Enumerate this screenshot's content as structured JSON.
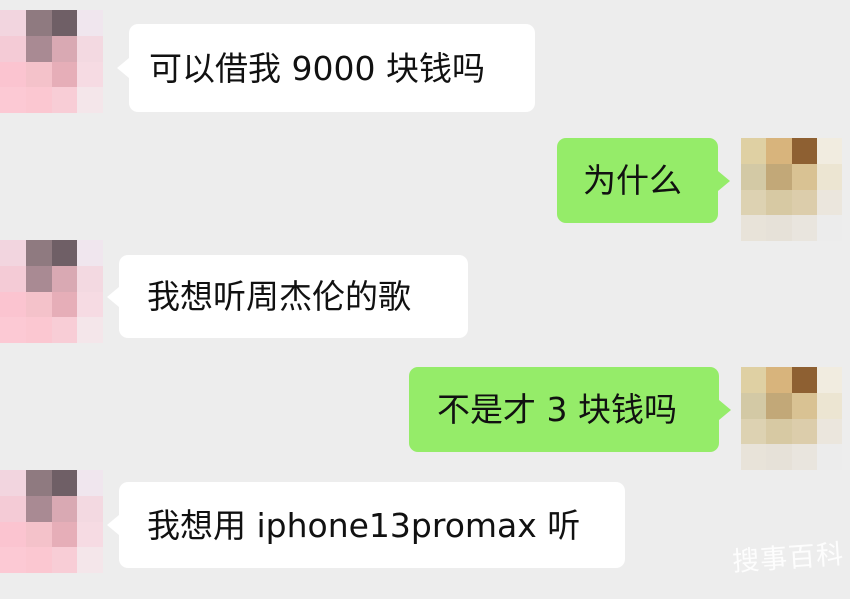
{
  "colors": {
    "background": "#ededed",
    "incoming_bubble": "#ffffff",
    "outgoing_bubble": "#95ec69"
  },
  "messages": [
    {
      "side": "in",
      "text": "可以借我 9000 块钱吗"
    },
    {
      "side": "out",
      "text": "为什么"
    },
    {
      "side": "in",
      "text": "我想听周杰伦的歌"
    },
    {
      "side": "out",
      "text": "不是才 3 块钱吗"
    },
    {
      "side": "in",
      "text": "我想用 iphone13promax 听"
    }
  ],
  "avatars": {
    "left_icon": "pixelated-avatar-pink",
    "right_icon": "pixelated-avatar-tan"
  },
  "watermark": "搜事百科"
}
